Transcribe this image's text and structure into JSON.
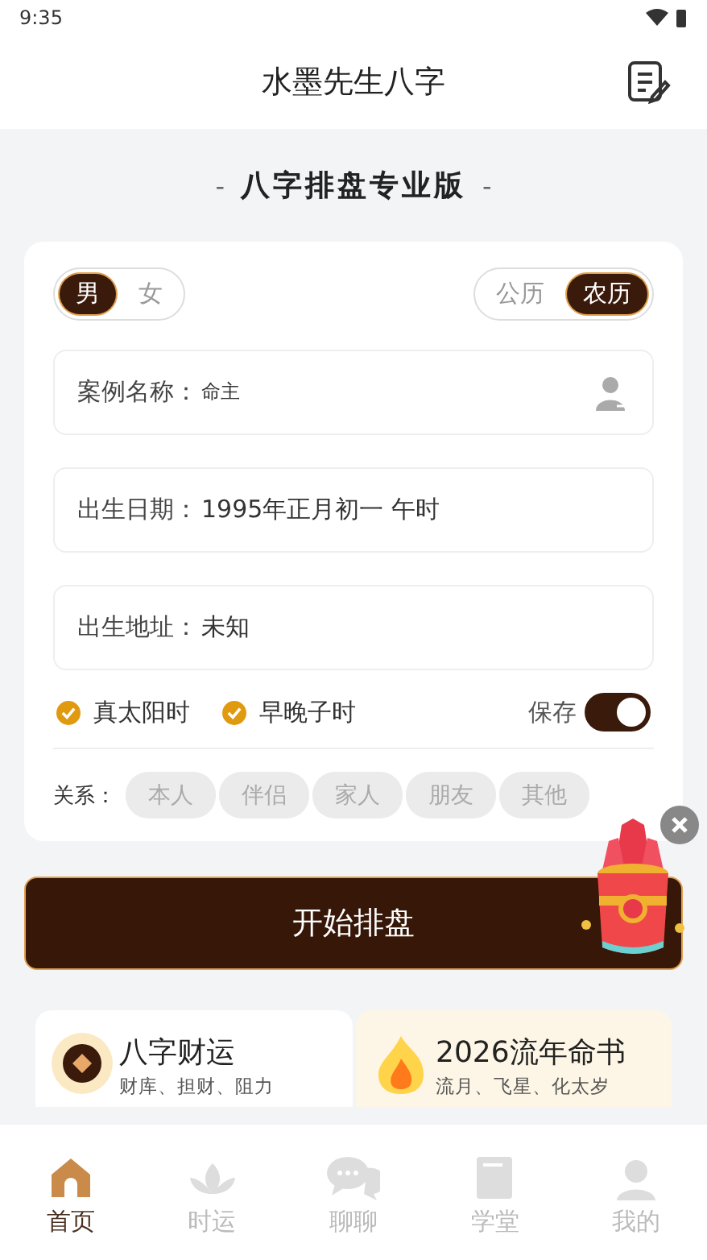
{
  "status_bar": {
    "time": "9:35"
  },
  "header": {
    "title": "水墨先生八字"
  },
  "banner": {
    "title": "八字排盘专业版",
    "dash": "-"
  },
  "gender": [
    {
      "label": "男",
      "selected": true
    },
    {
      "label": "女",
      "selected": false
    }
  ],
  "calendar": [
    {
      "label": "公历",
      "selected": false
    },
    {
      "label": "农历",
      "selected": true
    }
  ],
  "fields": [
    {
      "label": "案例名称：",
      "value": "命主",
      "kind": "name"
    },
    {
      "label": "出生日期：",
      "value": "1995年正月初一 午时",
      "kind": "plain"
    },
    {
      "label": "出生地址：",
      "value": "未知",
      "kind": "plain"
    }
  ],
  "options": [
    {
      "label": "真太阳时",
      "checked": true
    },
    {
      "label": "早晚子时",
      "checked": true
    }
  ],
  "save": {
    "label": "保存",
    "on": true
  },
  "relation": {
    "label": "关系：",
    "items": [
      {
        "label": "本人",
        "selected": false
      },
      {
        "label": "伴侣",
        "selected": false
      },
      {
        "label": "家人",
        "selected": false
      },
      {
        "label": "朋友",
        "selected": false
      },
      {
        "label": "其他",
        "selected": false
      }
    ]
  },
  "start_button": "开始排盘",
  "cards": [
    {
      "title": "八字财运",
      "subtitle": "财库、担财、阻力",
      "kind": "coin"
    },
    {
      "title": "2026流年命书",
      "subtitle": "流月、飞星、化太岁",
      "kind": "fire"
    }
  ],
  "tabs": [
    {
      "label": "首页",
      "selected": true,
      "kind": "home"
    },
    {
      "label": "时运",
      "selected": false,
      "kind": "lotus"
    },
    {
      "label": "聊聊",
      "selected": false,
      "kind": "chat"
    },
    {
      "label": "学堂",
      "selected": false,
      "kind": "book"
    },
    {
      "label": "我的",
      "selected": false,
      "kind": "user"
    }
  ]
}
